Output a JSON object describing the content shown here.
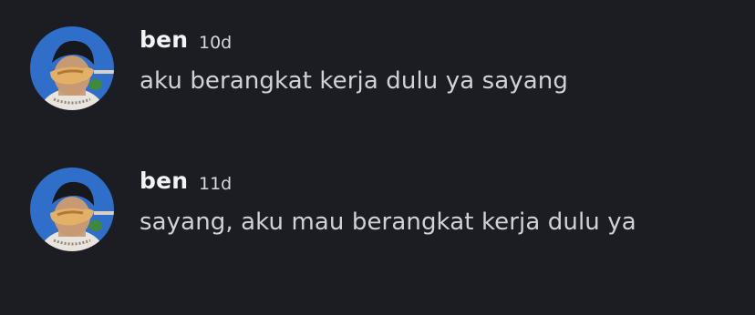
{
  "messages": [
    {
      "author": "ben",
      "time": "10d",
      "text": "aku berangkat kerja dulu ya sayang",
      "avatar_icon": "user-avatar-photo"
    },
    {
      "author": "ben",
      "time": "11d",
      "text": "sayang, aku mau berangkat kerja dulu ya",
      "avatar_icon": "user-avatar-photo"
    }
  ],
  "colors": {
    "background": "#1c1d22",
    "author": "#f2f3f5",
    "timestamp": "#d7d8dc",
    "message_text": "#d0d2d8"
  }
}
